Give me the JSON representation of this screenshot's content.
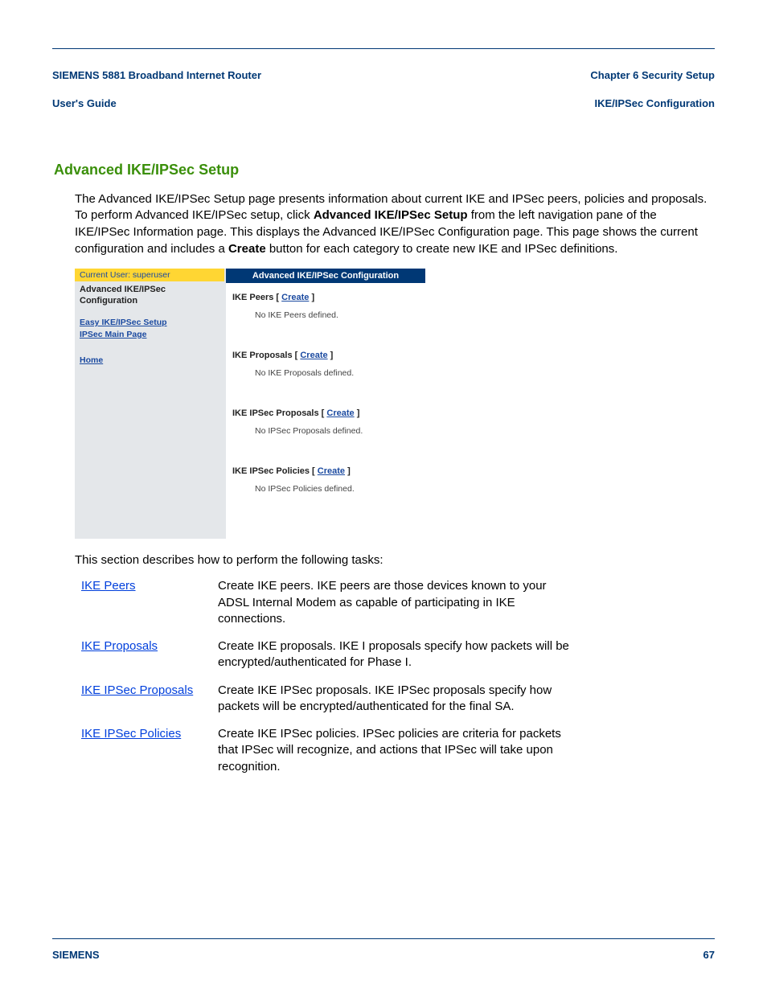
{
  "header": {
    "left_line1": "SIEMENS 5881 Broadband Internet Router",
    "left_line2": "User's Guide",
    "right_line1": "Chapter 6  Security Setup",
    "right_line2": "IKE/IPSec Configuration"
  },
  "section": {
    "title": "Advanced IKE/IPSec Setup"
  },
  "para1": {
    "t1": "The Advanced IKE/IPSec Setup page presents information about current IKE and IPSec peers, policies and proposals. To perform Advanced IKE/IPSec setup, click ",
    "bold1": "Advanced IKE/IPSec Setup",
    "t2": " from the left navigation pane of the IKE/IPSec Information page. This displays the Advanced IKE/IPSec Configuration page. This page shows the current configuration and includes a ",
    "bold2": "Create",
    "t3": " button for each category to create new IKE and IPSec definitions."
  },
  "screenshot": {
    "current_user": "Current User: superuser",
    "side_title": "Advanced IKE/IPSec Configuration",
    "side_links": {
      "easy": "Easy IKE/IPSec Setup",
      "main": "IPSec Main Page",
      "home": "Home"
    },
    "main_title": "Advanced IKE/IPSec Configuration",
    "create": "Create",
    "sections": {
      "peers": {
        "label": "IKE Peers",
        "empty": "No IKE Peers defined."
      },
      "proposals": {
        "label": "IKE Proposals",
        "empty": "No IKE Proposals defined."
      },
      "ipsec_proposals": {
        "label": "IKE IPSec Proposals",
        "empty": "No IPSec Proposals defined."
      },
      "policies": {
        "label": "IKE IPSec Policies",
        "empty": "No IPSec Policies defined."
      }
    }
  },
  "tasks_intro": "This section describes how to perform the following tasks:",
  "tasks": [
    {
      "term": "IKE Peers",
      "desc": "Create IKE peers. IKE peers are those devices known to your ADSL Internal Modem as capable of participating in IKE connections."
    },
    {
      "term": "IKE Proposals",
      "desc": "Create IKE proposals. IKE I proposals specify how packets will be encrypted/authenticated for Phase I."
    },
    {
      "term": "IKE IPSec Proposals",
      "desc": "Create IKE IPSec proposals. IKE IPSec proposals specify how packets will be encrypted/authenticated for the final SA."
    },
    {
      "term": "IKE IPSec Policies",
      "desc": "Create IKE IPSec policies. IPSec policies are criteria for packets that IPSec will recognize, and actions that IPSec will take upon recognition."
    }
  ],
  "footer": {
    "brand": "SIEMENS",
    "page": "67"
  }
}
